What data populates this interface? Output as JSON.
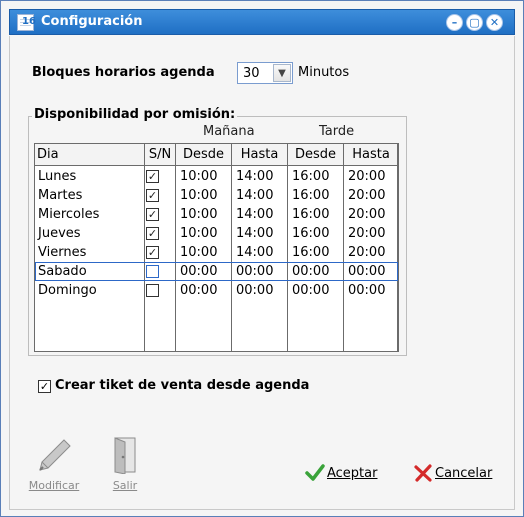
{
  "window": {
    "title": "Configuración",
    "icon": "calendar-icon",
    "icon_number": "16"
  },
  "bloques": {
    "label": "Bloques horarios agenda",
    "value": "30",
    "unit": "Minutos"
  },
  "disponibilidad": {
    "title": "Disponibilidad por omisión:",
    "manana_label": "Mañana",
    "tarde_label": "Tarde",
    "columns": [
      "Dia",
      "S/N",
      "Desde",
      "Hasta",
      "Desde",
      "Hasta"
    ],
    "rows": [
      {
        "dia": "Lunes",
        "checked": true,
        "m_desde": "10:00",
        "m_hasta": "14:00",
        "t_desde": "16:00",
        "t_hasta": "20:00",
        "mark": "✓"
      },
      {
        "dia": "Martes",
        "checked": true,
        "m_desde": "10:00",
        "m_hasta": "14:00",
        "t_desde": "16:00",
        "t_hasta": "20:00",
        "mark": "✓"
      },
      {
        "dia": "Miercoles",
        "checked": true,
        "m_desde": "10:00",
        "m_hasta": "14:00",
        "t_desde": "16:00",
        "t_hasta": "20:00",
        "mark": "✓"
      },
      {
        "dia": "Jueves",
        "checked": true,
        "m_desde": "10:00",
        "m_hasta": "14:00",
        "t_desde": "16:00",
        "t_hasta": "20:00",
        "mark": "✓"
      },
      {
        "dia": "Viernes",
        "checked": true,
        "m_desde": "10:00",
        "m_hasta": "14:00",
        "t_desde": "16:00",
        "t_hasta": "20:00",
        "mark": "✓"
      },
      {
        "dia": "Sabado",
        "checked": false,
        "m_desde": "00:00",
        "m_hasta": "00:00",
        "t_desde": "00:00",
        "t_hasta": "00:00",
        "mark": ""
      },
      {
        "dia": "Domingo",
        "checked": false,
        "m_desde": "00:00",
        "m_hasta": "00:00",
        "t_desde": "00:00",
        "t_hasta": "00:00",
        "mark": ""
      }
    ],
    "selected_row": 5
  },
  "crear_ticket": {
    "label": "Crear tiket de venta desde agenda",
    "checked": true,
    "mark": "✓"
  },
  "toolbar": {
    "modificar_label": "Modificar",
    "modificar_icon": "pen-icon",
    "salir_label": "Salir",
    "salir_icon": "door-icon"
  },
  "actions": {
    "aceptar_label": "Aceptar",
    "aceptar_icon": "green-check-icon",
    "cancelar_label": "Cancelar",
    "cancelar_icon": "red-x-icon"
  },
  "colors": {
    "titlebar": "#2a7fd4",
    "accent": "#2d68c7"
  }
}
